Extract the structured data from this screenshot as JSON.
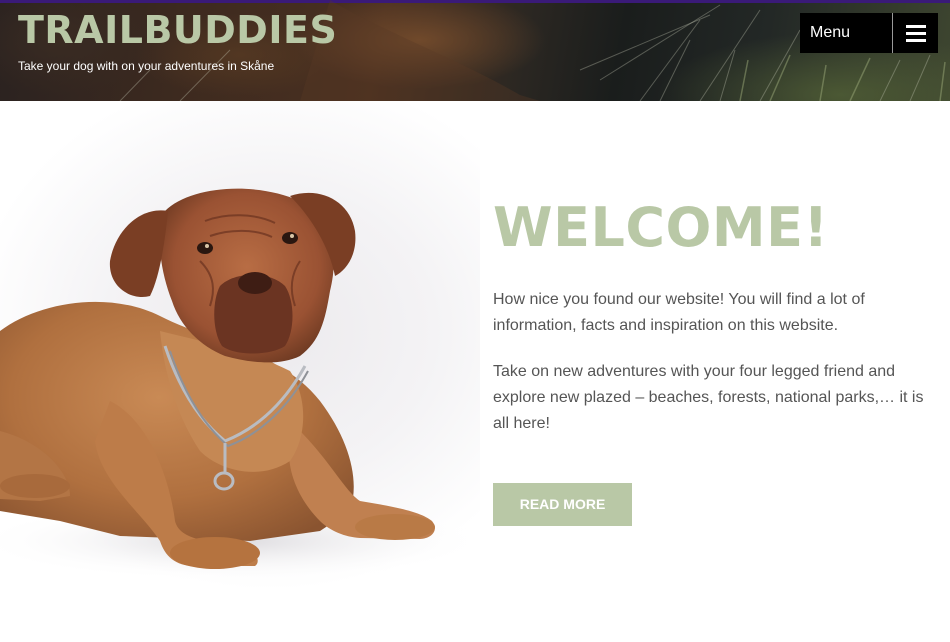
{
  "header": {
    "site_title": "TRAILBUDDIES",
    "tagline": "Take your dog with on your adventures in Skåne",
    "menu_label": "Menu",
    "menu_icon": "hamburger-icon",
    "background_image": "dog-in-grass"
  },
  "hero": {
    "image": "dogue-de-bordeaux-lying",
    "title": "WELCOME!",
    "paragraphs": [
      "How nice you found our website! You will find a lot of information, facts and inspiration on this website.",
      "Take on new adventures with your four legged friend and explore new plazed – beaches, forests, national parks,… it is all here!"
    ],
    "button_label": "READ MORE"
  },
  "colors": {
    "accent": "#b9c8a6",
    "header_top_line": "#3a1a78",
    "menu_bg": "#000000",
    "body_text": "#555555"
  }
}
